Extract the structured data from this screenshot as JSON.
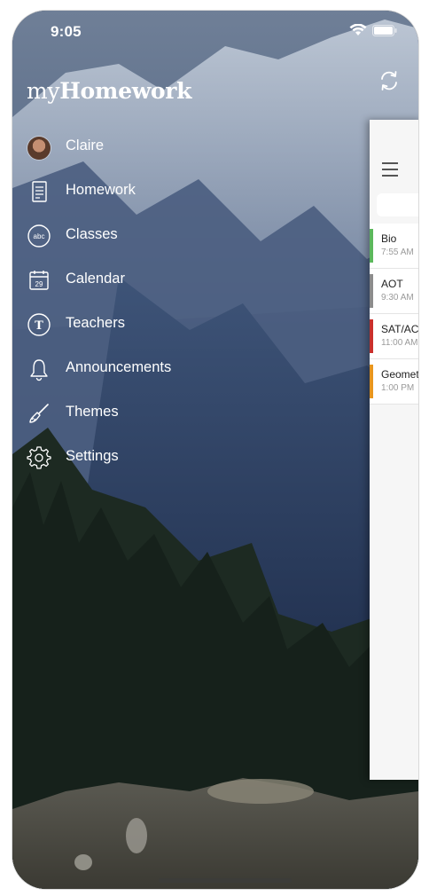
{
  "status_bar": {
    "time": "9:05"
  },
  "app": {
    "title_prefix": "my",
    "title_main": "Homework"
  },
  "menu": [
    {
      "label": "Claire",
      "icon": "avatar"
    },
    {
      "label": "Homework",
      "icon": "homework-icon"
    },
    {
      "label": "Classes",
      "icon": "classes-abc-icon",
      "icon_text": "abc"
    },
    {
      "label": "Calendar",
      "icon": "calendar-icon",
      "icon_text": "29"
    },
    {
      "label": "Teachers",
      "icon": "teachers-icon",
      "icon_text": "T"
    },
    {
      "label": "Announcements",
      "icon": "bell-icon"
    },
    {
      "label": "Themes",
      "icon": "paintbrush-icon"
    },
    {
      "label": "Settings",
      "icon": "gear-icon"
    }
  ],
  "homework_list": [
    {
      "name": "Bio",
      "time": "7:55 AM",
      "color": "#5cb85c"
    },
    {
      "name": "AOT",
      "time": "9:30 AM",
      "color": "#8c8c8c"
    },
    {
      "name": "SAT/ACT",
      "time": "11:00 AM",
      "color": "#c9302c"
    },
    {
      "name": "Geometry",
      "time": "1:00 PM",
      "color": "#e8961e"
    }
  ]
}
